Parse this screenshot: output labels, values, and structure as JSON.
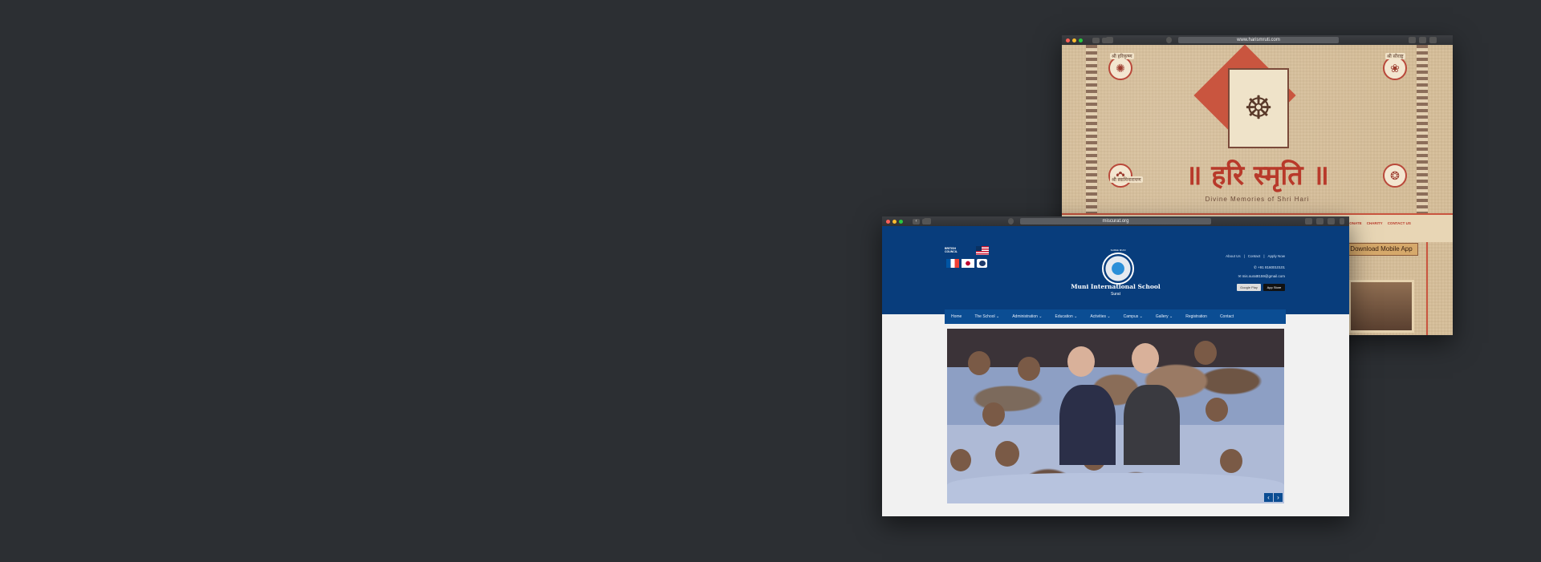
{
  "back_window": {
    "url": "www.harismruti.com",
    "title_devanagari": "॥ हरि स्मृति ॥",
    "subtitle": "Divine Memories of Shri Hari",
    "corner_labels": [
      "श्री हरिकृष्ण",
      "श्री सौराष्ट्र",
      "श्री स्वामिनारायण",
      ""
    ],
    "menu": [
      "ESS",
      "DONATE",
      "CHARITY",
      "CONTACT US"
    ],
    "download_button": "Download Mobile App"
  },
  "front_window": {
    "url": "miscurat.org",
    "top_links": [
      "About Us",
      "|",
      "Contact",
      "|",
      "Apply Now"
    ],
    "phone": "+91 8160010101",
    "email": "mis.surat8159@gmail.com",
    "stores": [
      "Google Play",
      "App Store"
    ],
    "logo_top": "SHREE MUNI",
    "school_name": "Muni International School",
    "school_city": "Surat",
    "british_council": "BRITISH COUNCIL",
    "nav": [
      "Home",
      "The School ⌄",
      "Administration ⌄",
      "Education ⌄",
      "Activities ⌄",
      "Campus ⌄",
      "Gallery ⌄",
      "Registration",
      "Contact"
    ],
    "slider_prev": "‹",
    "slider_next": "›"
  },
  "colors": {
    "background": "#2c2f33",
    "school_header": "#083d7c",
    "school_nav": "#0b4d93",
    "hari_red": "#b8392a",
    "hari_parchment": "#d8c19e"
  }
}
